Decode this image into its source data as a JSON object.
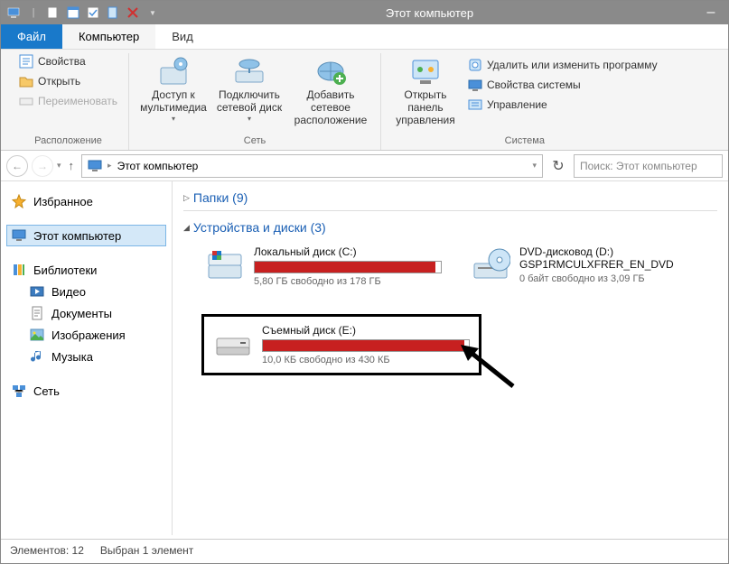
{
  "window": {
    "title": "Этот компьютер"
  },
  "tabs": {
    "file": "Файл",
    "computer": "Компьютер",
    "view": "Вид"
  },
  "ribbon": {
    "group_location": {
      "label": "Расположение",
      "props": "Свойства",
      "open": "Открыть",
      "rename": "Переименовать"
    },
    "group_network": {
      "label": "Сеть",
      "media": "Доступ к мультимедиа",
      "map_drive": "Подключить сетевой диск",
      "add_loc": "Добавить сетевое расположение"
    },
    "group_system": {
      "label": "Система",
      "ctrl_panel": "Открыть панель управления",
      "uninstall": "Удалить или изменить программу",
      "sysprops": "Свойства системы",
      "manage": "Управление"
    }
  },
  "address": {
    "path": "Этот компьютер",
    "search_placeholder": "Поиск: Этот компьютер"
  },
  "sidebar": {
    "favorites": "Избранное",
    "this_pc": "Этот компьютер",
    "libraries": "Библиотеки",
    "video": "Видео",
    "documents": "Документы",
    "pictures": "Изображения",
    "music": "Музыка",
    "network": "Сеть"
  },
  "main": {
    "folders_hdr": "Папки (9)",
    "devices_hdr": "Устройства и диски (3)",
    "devices": [
      {
        "name": "Локальный диск (C:)",
        "free": "5,80 ГБ свободно из 178 ГБ",
        "fill_pct": 97,
        "show_bar": true,
        "icon": "hdd"
      },
      {
        "name": "DVD-дисковод (D:) GSP1RMCULXFRER_EN_DVD",
        "free": "0 байт свободно из 3,09 ГБ",
        "fill_pct": 0,
        "show_bar": false,
        "icon": "dvd"
      },
      {
        "name": "Съемный диск (E:)",
        "free": "10,0 КБ свободно из 430 КБ",
        "fill_pct": 98,
        "show_bar": true,
        "icon": "removable",
        "highlighted": true
      }
    ]
  },
  "statusbar": {
    "elements": "Элементов: 12",
    "selected": "Выбран 1 элемент"
  }
}
